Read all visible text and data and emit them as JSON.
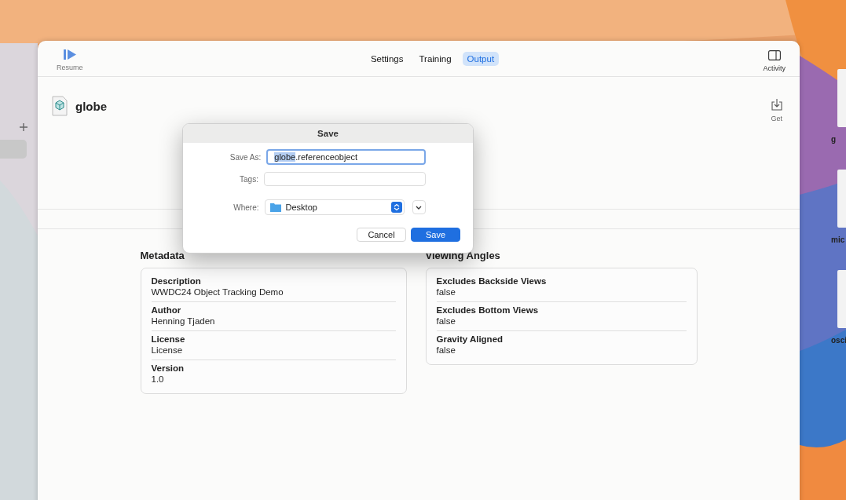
{
  "toolbar": {
    "resume": "Resume",
    "tabs": [
      {
        "label": "Settings",
        "selected": false
      },
      {
        "label": "Training",
        "selected": false
      },
      {
        "label": "Output",
        "selected": true
      }
    ],
    "activity": "Activity"
  },
  "document": {
    "title": "globe",
    "get": "Get"
  },
  "sections": [
    {
      "title": "Metadata",
      "fields": [
        {
          "label": "Description",
          "value": "WWDC24 Object Tracking Demo"
        },
        {
          "label": "Author",
          "value": "Henning Tjaden"
        },
        {
          "label": "License",
          "value": "License"
        },
        {
          "label": "Version",
          "value": "1.0"
        }
      ]
    },
    {
      "title": "Viewing Angles",
      "fields": [
        {
          "label": "Excludes Backside Views",
          "value": "false"
        },
        {
          "label": "Excludes Bottom Views",
          "value": "false"
        },
        {
          "label": "Gravity Aligned",
          "value": "false"
        }
      ]
    }
  ],
  "save_dialog": {
    "title": "Save",
    "save_as_label": "Save As:",
    "filename": {
      "selected": "globe",
      "rest": ".referenceobject"
    },
    "tags_label": "Tags:",
    "where_label": "Where:",
    "where_value": "Desktop",
    "buttons": [
      {
        "label": "Cancel",
        "default": false
      },
      {
        "label": "Save",
        "default": true
      }
    ]
  },
  "desktop_icons": [
    {
      "label": "g"
    },
    {
      "label": "mic"
    },
    {
      "label": "osci"
    }
  ]
}
